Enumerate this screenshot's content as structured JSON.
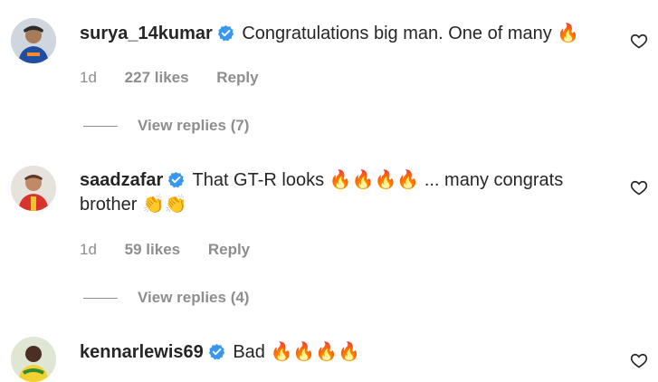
{
  "comments": [
    {
      "username": "surya_14kumar",
      "text": "Congratulations big man. One of many",
      "emojis": "🔥",
      "emojis_line2": "",
      "time": "1d",
      "likes": "227 likes",
      "reply": "Reply",
      "view_replies": "View replies (7)"
    },
    {
      "username": "saadzafar",
      "text": "That GT-R looks",
      "emojis": "🔥🔥🔥🔥",
      "text_after": " ... many congrats",
      "line2": "brother",
      "emojis_line2": "👏👏",
      "time": "1d",
      "likes": "59 likes",
      "reply": "Reply",
      "view_replies": "View replies (4)"
    },
    {
      "username": "kennarlewis69",
      "text": "Bad",
      "emojis": "🔥🔥🔥🔥"
    }
  ],
  "colors": {
    "verified": "#3897f0",
    "muted": "#8e8e8e",
    "text": "#262626"
  }
}
